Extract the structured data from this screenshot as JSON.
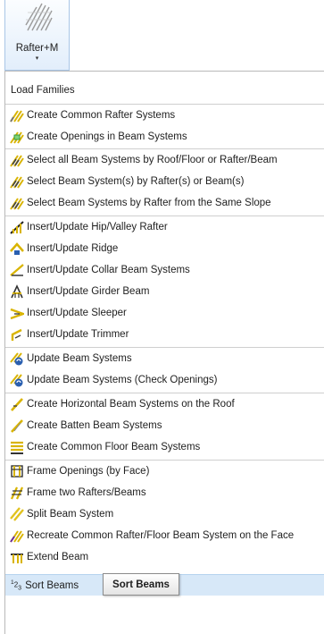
{
  "ribbon": {
    "label": "Rafter+M",
    "dropdown_glyph": "▾"
  },
  "menu": {
    "items": [
      {
        "label": "Load Families",
        "icon": "none"
      },
      {
        "label": "Create Common Rafter Systems",
        "icon": "rafter-system-icon"
      },
      {
        "label": "Create Openings in Beam Systems",
        "icon": "opening-icon"
      },
      {
        "label": "Select all Beam Systems by Roof/Floor or Rafter/Beam",
        "icon": "select-icon"
      },
      {
        "label": "Select Beam System(s) by Rafter(s) or Beam(s)",
        "icon": "select-icon"
      },
      {
        "label": "Select Beam Systems by Rafter from the Same Slope",
        "icon": "select-icon"
      },
      {
        "label": "Insert/Update Hip/Valley Rafter",
        "icon": "hip-valley-icon"
      },
      {
        "label": "Insert/Update Ridge",
        "icon": "ridge-icon"
      },
      {
        "label": "Insert/Update Collar Beam Systems",
        "icon": "collar-beam-icon"
      },
      {
        "label": "Insert/Update Girder Beam",
        "icon": "girder-icon"
      },
      {
        "label": "Insert/Update Sleeper",
        "icon": "sleeper-icon"
      },
      {
        "label": "Insert/Update Trimmer",
        "icon": "trimmer-icon"
      },
      {
        "label": "Update Beam Systems",
        "icon": "update-icon"
      },
      {
        "label": "Update Beam Systems (Check Openings)",
        "icon": "update-icon"
      },
      {
        "label": "Create Horizontal Beam Systems on the Roof",
        "icon": "horizontal-beam-icon"
      },
      {
        "label": "Create Batten Beam Systems",
        "icon": "batten-icon"
      },
      {
        "label": "Create Common Floor Beam Systems",
        "icon": "floor-beam-icon"
      },
      {
        "label": "Frame Openings (by Face)",
        "icon": "frame-opening-icon"
      },
      {
        "label": "Frame two Rafters/Beams",
        "icon": "frame-rafters-icon"
      },
      {
        "label": "Split Beam System",
        "icon": "split-icon"
      },
      {
        "label": "Recreate Common Rafter/Floor Beam System on the Face",
        "icon": "recreate-icon"
      },
      {
        "label": "Extend Beam",
        "icon": "extend-icon"
      },
      {
        "label": "Sort Beams",
        "icon": "sort-icon",
        "icon_text_base": "1",
        "icon_text_sub": "2",
        "icon_text_tail": "3"
      }
    ]
  },
  "tooltip": {
    "text": "Sort Beams"
  },
  "colors": {
    "highlight": "#d7e8f8",
    "rafter_yellow": "#e8c81a",
    "accent_blue": "#2a5fb0"
  }
}
